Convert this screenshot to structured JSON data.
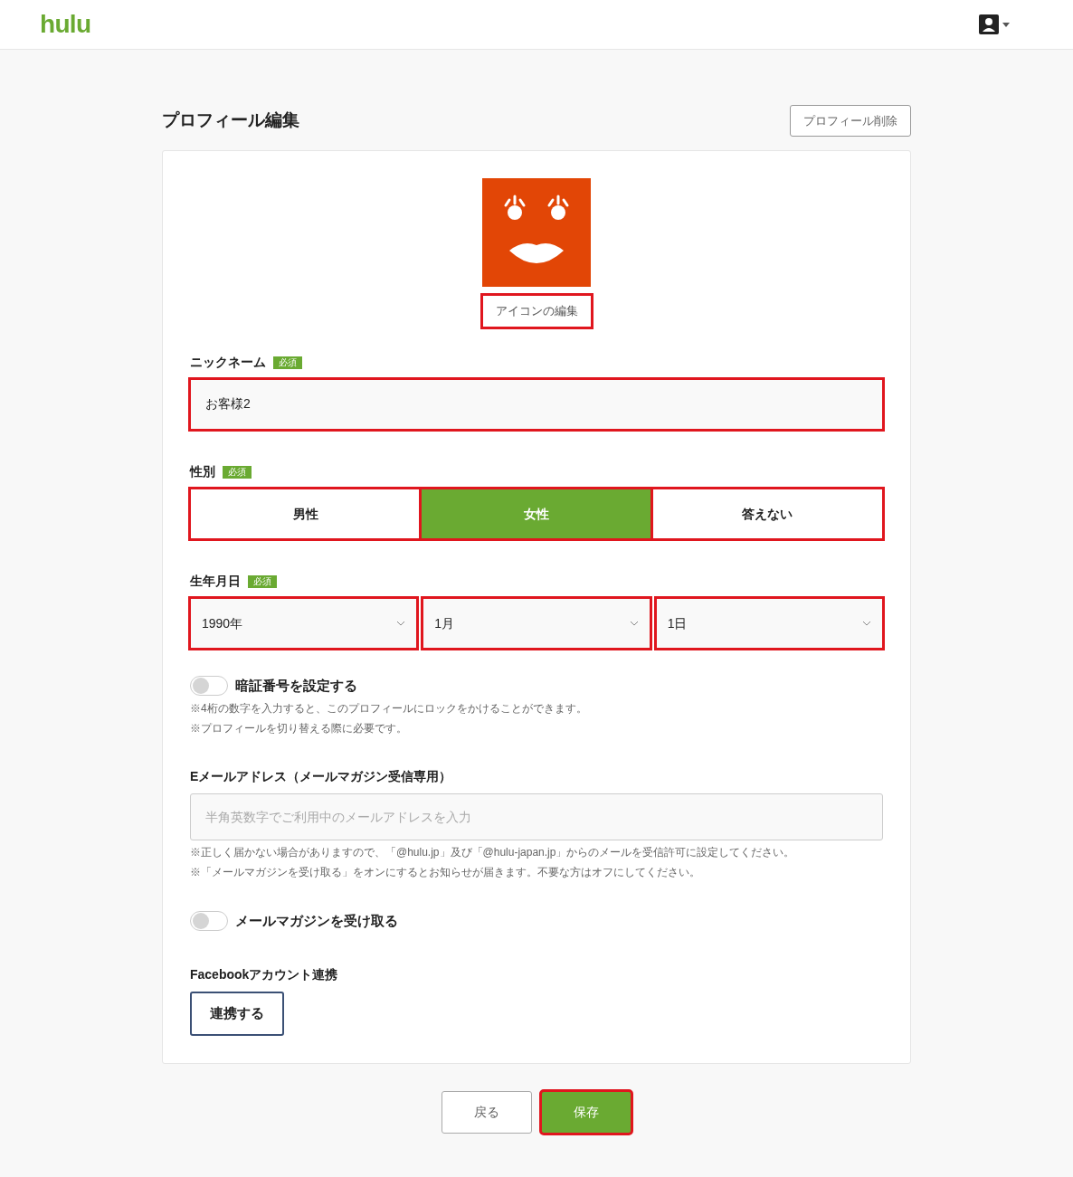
{
  "header": {
    "logo": "hulu"
  },
  "page": {
    "title": "プロフィール編集",
    "delete_button": {
      "label": "プロフィール削除",
      "highlighted": false
    }
  },
  "icon_edit": {
    "label": "アイコンの編集",
    "highlighted": true
  },
  "nickname": {
    "label": "ニックネーム",
    "badge": "必須",
    "value": "お客様2",
    "highlighted": true
  },
  "gender": {
    "label": "性別",
    "badge": "必須",
    "options": [
      {
        "label": "男性",
        "selected": false,
        "highlighted": true
      },
      {
        "label": "女性",
        "selected": true,
        "highlighted": true
      },
      {
        "label": "答えない",
        "selected": false,
        "highlighted": true
      }
    ]
  },
  "birthday": {
    "label": "生年月日",
    "badge": "必須",
    "selects": [
      {
        "value": "1990年",
        "highlighted": true
      },
      {
        "value": "1月",
        "highlighted": true
      },
      {
        "value": "1日",
        "highlighted": true
      }
    ]
  },
  "pin": {
    "label": "暗証番号を設定する",
    "on": false,
    "notes": [
      "※4桁の数字を入力すると、このプロフィールにロックをかけることができます。",
      "※プロフィールを切り替える際に必要です。"
    ]
  },
  "email": {
    "label": "Eメールアドレス（メールマガジン受信専用）",
    "placeholder": "半角英数字でご利用中のメールアドレスを入力",
    "highlighted": false,
    "notes": [
      "※正しく届かない場合がありますので、「@hulu.jp」及び「@hulu-japan.jp」からのメールを受信許可に設定してください。",
      "※「メールマガジンを受け取る」をオンにするとお知らせが届きます。不要な方はオフにしてください。"
    ]
  },
  "newsletter": {
    "label": "メールマガジンを受け取る",
    "on": false
  },
  "facebook": {
    "label": "Facebookアカウント連携",
    "button": "連携する"
  },
  "actions": [
    {
      "label": "戻る",
      "kind": "secondary",
      "highlighted": false
    },
    {
      "label": "保存",
      "kind": "primary",
      "highlighted": true
    }
  ]
}
